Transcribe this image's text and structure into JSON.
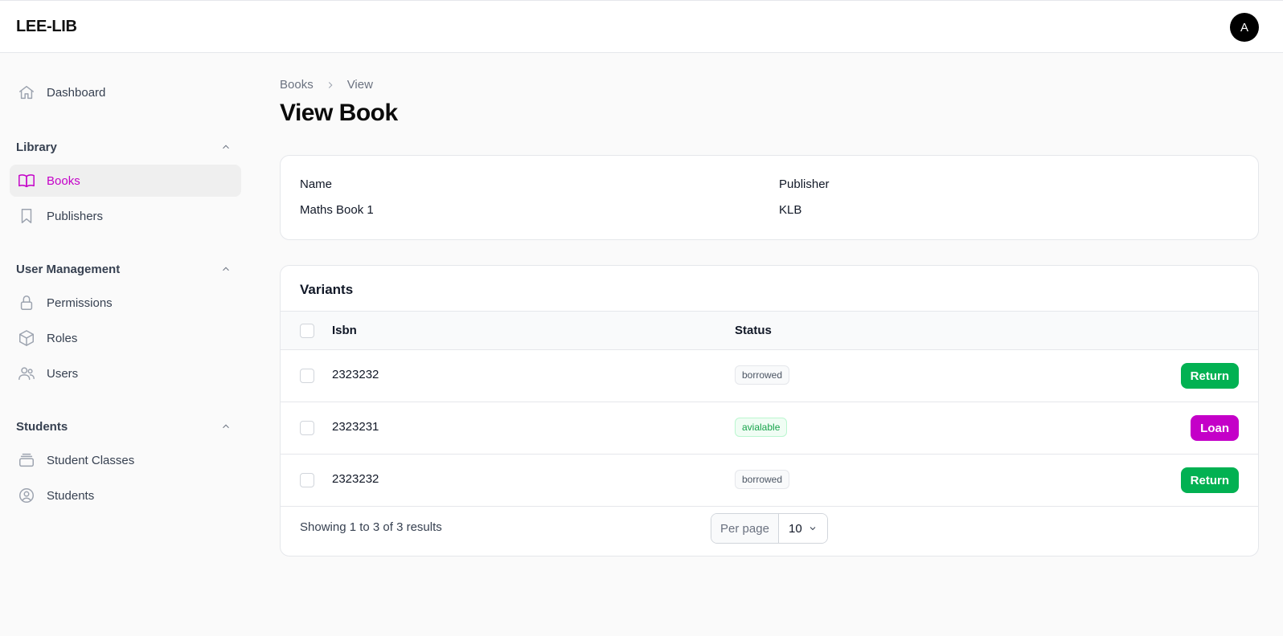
{
  "app": {
    "brand": "LEE-LIB",
    "avatar_initial": "A"
  },
  "sidebar": {
    "dashboard": {
      "label": "Dashboard",
      "icon": "home-icon"
    },
    "groups": [
      {
        "title": "Library",
        "items": [
          {
            "label": "Books",
            "icon": "book-open-icon",
            "active": true
          },
          {
            "label": "Publishers",
            "icon": "bookmark-icon"
          }
        ]
      },
      {
        "title": "User Management",
        "items": [
          {
            "label": "Permissions",
            "icon": "lock-icon"
          },
          {
            "label": "Roles",
            "icon": "cube-icon"
          },
          {
            "label": "Users",
            "icon": "users-icon"
          }
        ]
      },
      {
        "title": "Students",
        "items": [
          {
            "label": "Student Classes",
            "icon": "stack-icon"
          },
          {
            "label": "Students",
            "icon": "user-circle-icon"
          }
        ]
      }
    ]
  },
  "breadcrumb": {
    "parent": "Books",
    "current": "View"
  },
  "page": {
    "title": "View Book"
  },
  "book": {
    "name_label": "Name",
    "name_value": "Maths Book 1",
    "publisher_label": "Publisher",
    "publisher_value": "KLB"
  },
  "variants": {
    "title": "Variants",
    "columns": {
      "isbn": "Isbn",
      "status": "Status"
    },
    "rows": [
      {
        "isbn": "2323232",
        "status": "borrowed",
        "action": "Return"
      },
      {
        "isbn": "2323231",
        "status": "avialable",
        "action": "Loan"
      },
      {
        "isbn": "2323232",
        "status": "borrowed",
        "action": "Return"
      }
    ],
    "summary": "Showing 1 to 3 of 3 results",
    "per_page_label": "Per page",
    "per_page_value": "10"
  },
  "colors": {
    "accent": "#c400c8",
    "return_button": "#02b152",
    "available_text": "#16a34a"
  }
}
